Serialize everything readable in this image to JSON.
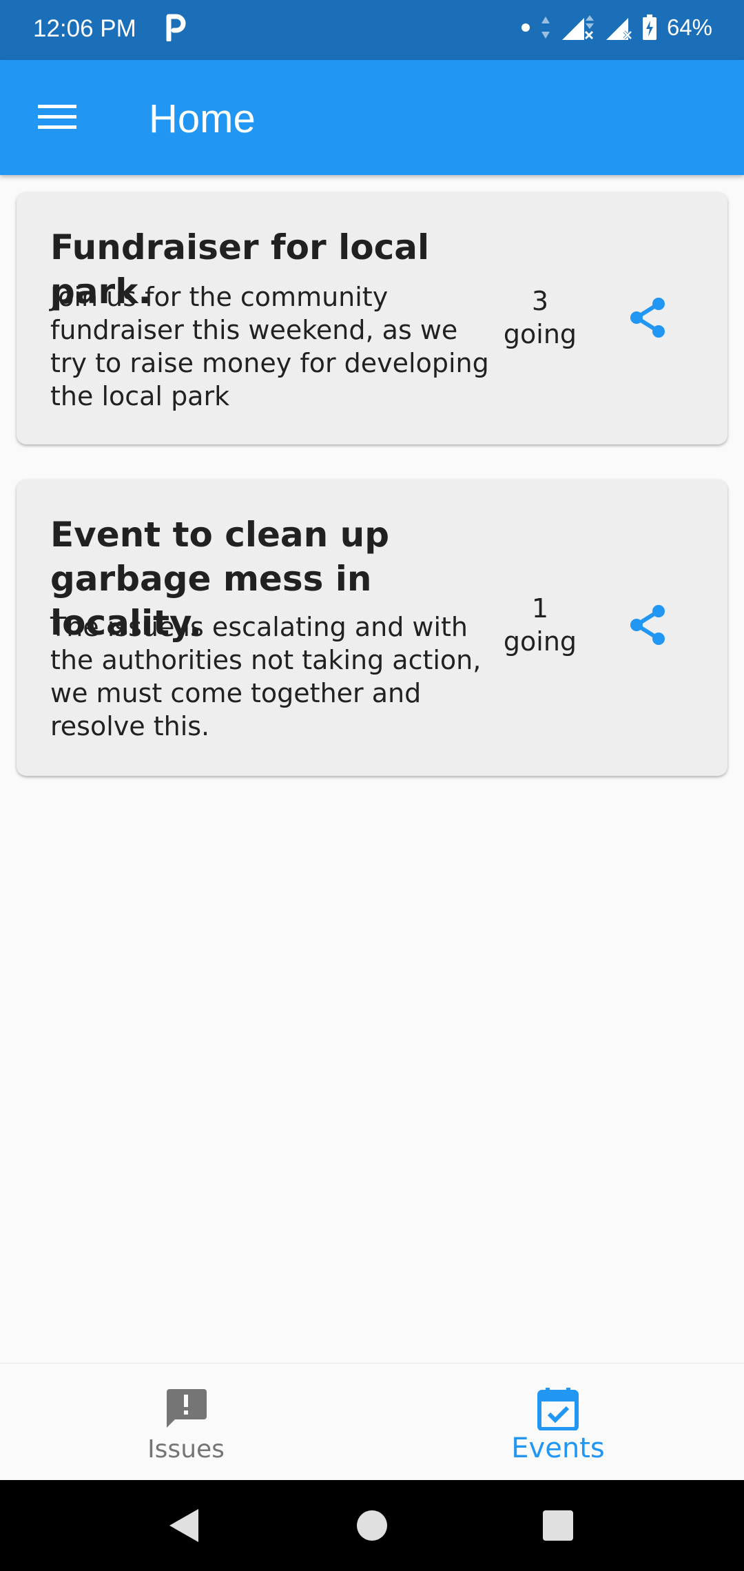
{
  "status_bar": {
    "time": "12:06 PM",
    "battery": "64%",
    "icons": [
      "parking-icon",
      "dot-icon",
      "data-arrows-icon",
      "signal-icon",
      "signal-icon",
      "battery-icon"
    ]
  },
  "app_bar": {
    "title": "Home",
    "menu_icon": "menu-icon"
  },
  "events": [
    {
      "title": "Fundraiser for local park.",
      "description": "Join us for the community fundraiser this weekend, as we try to raise money for developing the local park",
      "going_count": "3",
      "going_label": "going",
      "share_icon": "share-icon"
    },
    {
      "title": "Event to clean up garbage mess in locality.",
      "description": "The issue is escalating and with the authorities not taking action, we must come together and resolve this.",
      "going_count": "1",
      "going_label": "going",
      "share_icon": "share-icon"
    }
  ],
  "bottom_nav": {
    "items": [
      {
        "label": "Issues",
        "icon": "feedback-icon",
        "active": false
      },
      {
        "label": "Events",
        "icon": "event-available-icon",
        "active": true
      }
    ]
  },
  "colors": {
    "primary": "#2196f3",
    "status_bar": "#1b6fb8",
    "card_bg": "#eeeeee",
    "inactive": "#757575"
  }
}
